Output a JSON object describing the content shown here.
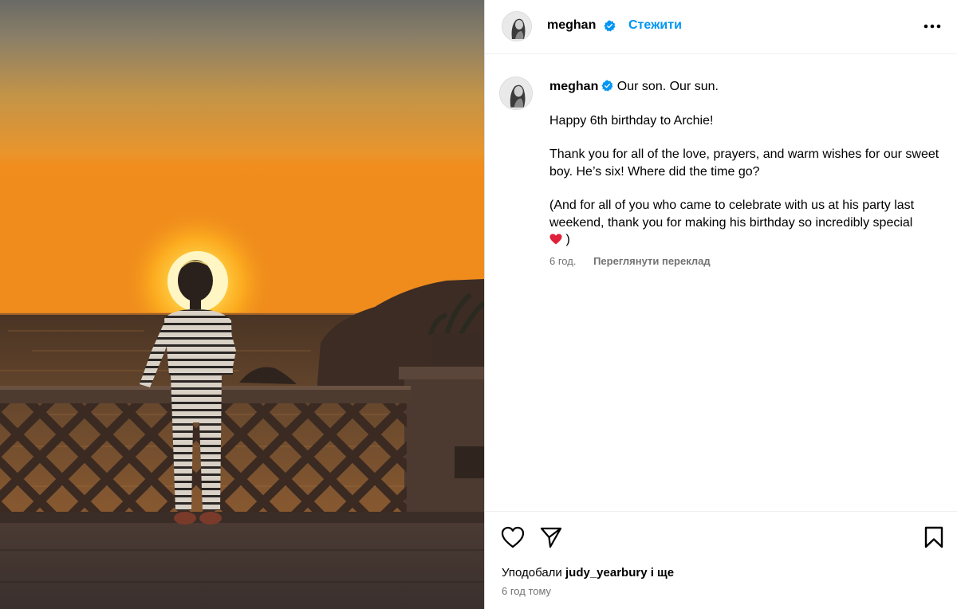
{
  "post": {
    "image_alt": "child at balcony railing watching sunset over the sea",
    "author": {
      "username": "meghan",
      "verified": true,
      "avatar_icon": "profile-photo-icon"
    },
    "header": {
      "follow_label": "Стежити",
      "more_icon": "more-options-icon"
    },
    "caption": {
      "first_line": "Our son. Our sun.",
      "line2": "Happy 6th birthday to Archie!",
      "line3": "Thank you for all of the love, prayers, and warm wishes for our sweet boy. He’s six! Where did the time go?",
      "line4": "(And for all of you who came to celebrate with us at his party last weekend, thank you for making his birthday so incredibly special",
      "line4_end": ")",
      "emoji": "red-heart-emoji",
      "time": "6 год.",
      "translate_label": "Переглянути переклад"
    },
    "actions": {
      "like_icon": "heart-icon",
      "share_icon": "send-icon",
      "save_icon": "bookmark-icon"
    },
    "likes": {
      "prefix": "Уподобали",
      "user": "judy_yearbury",
      "suffix": "і ще"
    },
    "posted_ago": "6 год тому"
  },
  "colors": {
    "link_blue": "#0095f6",
    "verified_blue": "#0095f6",
    "secondary_text": "#737373",
    "divider": "#dbdbdb",
    "sun": "#ffb21f"
  }
}
